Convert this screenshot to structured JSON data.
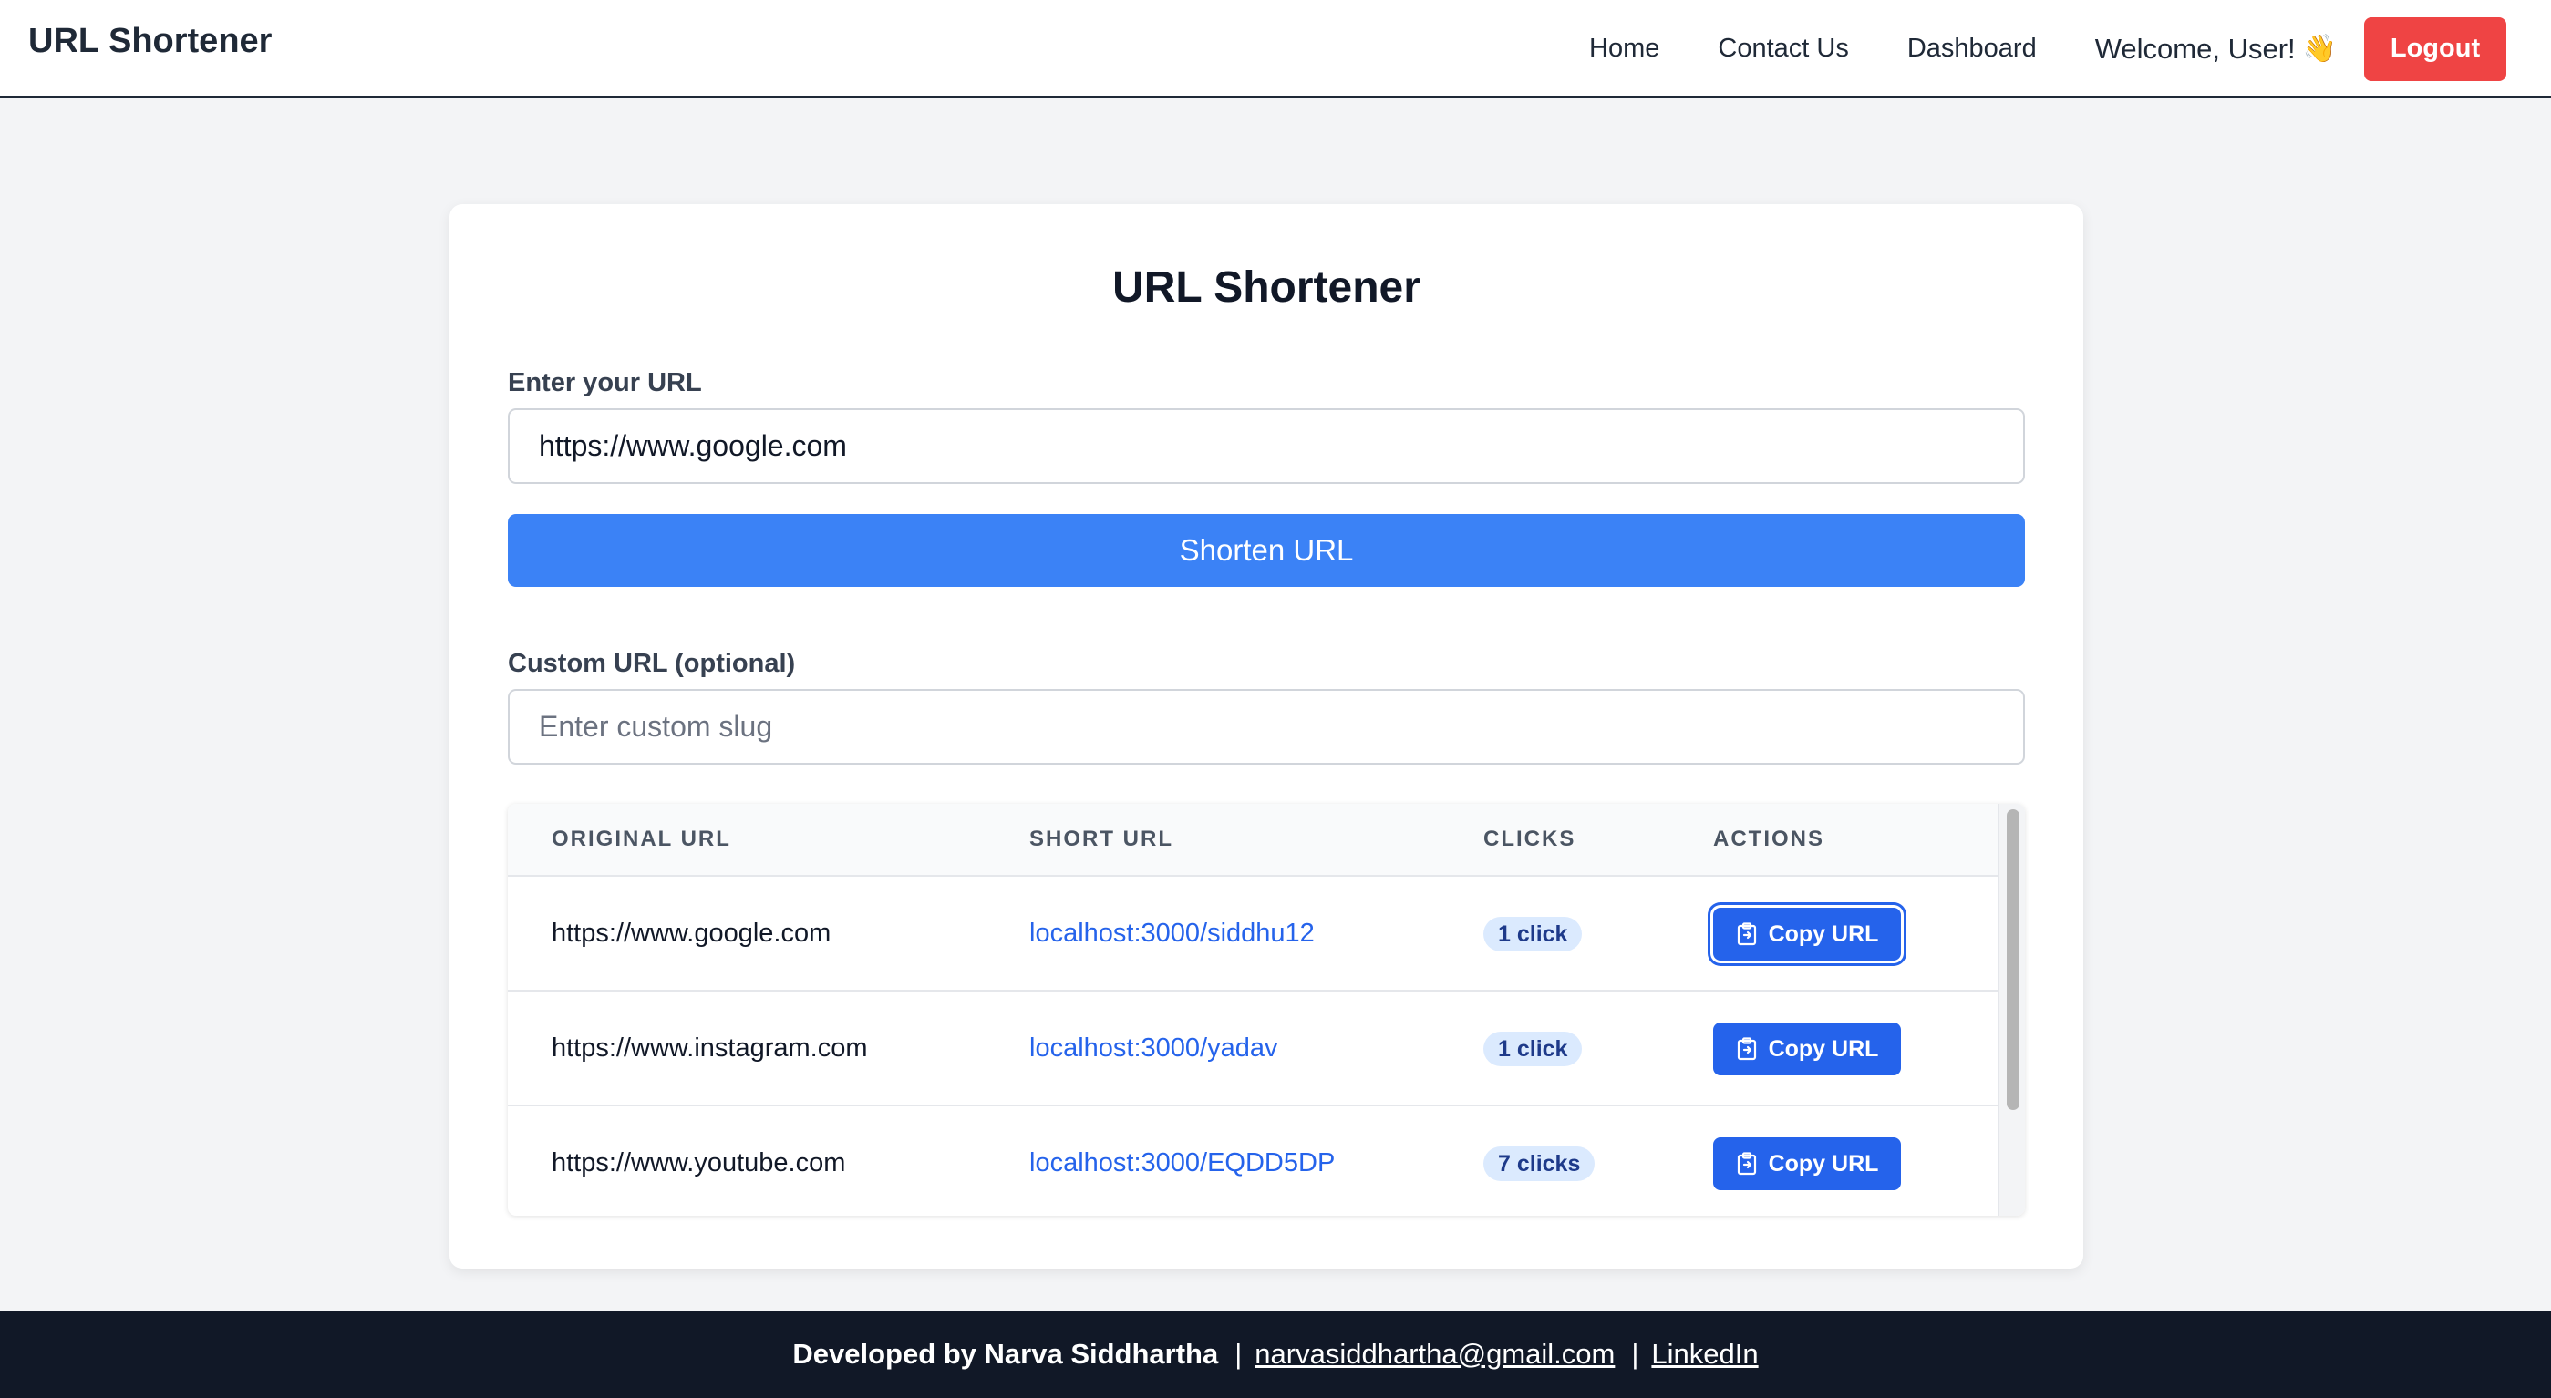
{
  "navbar": {
    "brand": "URL Shortener",
    "links": [
      "Home",
      "Contact Us",
      "Dashboard"
    ],
    "welcome": "Welcome, User!",
    "wave_emoji": "👋",
    "logout_label": "Logout"
  },
  "form": {
    "title": "URL Shortener",
    "url_label": "Enter your URL",
    "url_value": "https://www.google.com",
    "shorten_label": "Shorten URL",
    "custom_label": "Custom URL (optional)",
    "custom_placeholder": "Enter custom slug",
    "custom_value": ""
  },
  "table": {
    "headers": [
      "ORIGINAL URL",
      "SHORT URL",
      "CLICKS",
      "ACTIONS"
    ],
    "rows": [
      {
        "original": "https://www.google.com",
        "short": "localhost:3000/siddhu12",
        "clicks": "1 click",
        "action": "Copy URL"
      },
      {
        "original": "https://www.instagram.com",
        "short": "localhost:3000/yadav",
        "clicks": "1 click",
        "action": "Copy URL"
      },
      {
        "original": "https://www.youtube.com",
        "short": "localhost:3000/EQDD5DP",
        "clicks": "7 clicks",
        "action": "Copy URL"
      }
    ]
  },
  "footer": {
    "developer": "Developed by Narva Siddhartha",
    "separator": "|",
    "email": "narvasiddhartha@gmail.com",
    "linkedin": "LinkedIn"
  },
  "colors": {
    "primary": "#3b82f6",
    "button_blue": "#2563eb",
    "logout_red": "#ef4444",
    "footer_bg": "#111827",
    "page_bg": "#f3f4f6"
  },
  "icons": {
    "copy": "clipboard-copy-icon"
  }
}
